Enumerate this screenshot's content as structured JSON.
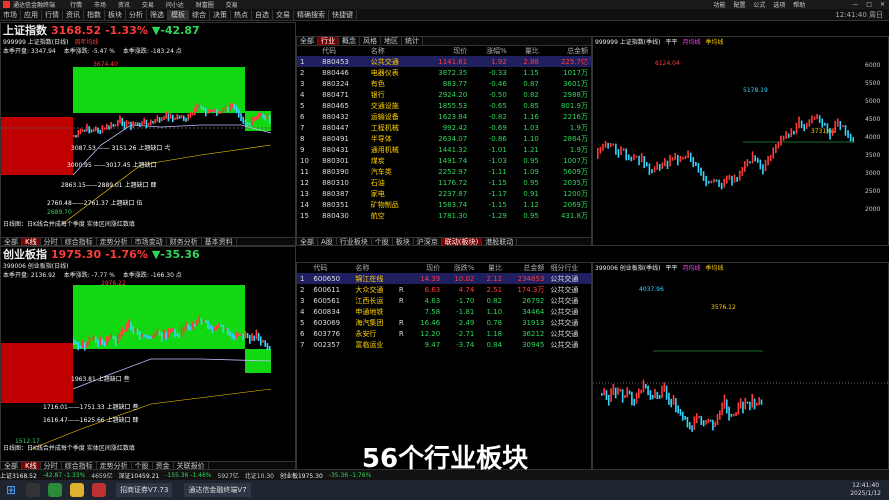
{
  "app": {
    "title": "通达信金融终端",
    "menu": [
      "行情",
      "市场",
      "资讯",
      "交易",
      "问小达",
      "财富圈",
      "交易"
    ],
    "window_controls": [
      "功能",
      "配置",
      "公式",
      "选项",
      "帮助"
    ]
  },
  "toolbar": [
    "市场",
    "应用",
    "行情",
    "资讯",
    "指数",
    "板块",
    "分析",
    "筛选",
    "模板",
    "综合",
    "决策",
    "热点",
    "自选",
    "交易"
  ],
  "toolbar_tail": [
    "精确搜索",
    "快捷键"
  ],
  "toolbar_right": "12:41:40 周日",
  "index1": {
    "code": "999999 上证指数(日线)",
    "name": "上证指数",
    "price": "3168.52",
    "pct": "-1.33%",
    "chg": "▼-42.87",
    "open_label": "本季开盘: 3347.94",
    "change_label": "本季涨跌: -5.47 %",
    "total_label": "本季涨跌: -183.24 点",
    "top_label": "3674.40",
    "low_label": "2689.70",
    "ma_label": "周年均线",
    "gaps": [
      "3087.53 —— 3151.26 上翘缺口 弌",
      "3000.95 ——3017.45 上翘缺口 ",
      "2863.15——2889.01 上翘缺口 肆",
      "2760.48——2761.37 上翘缺口 伍"
    ],
    "footer": "日线图：日K线合并成每个季度 实体区间涨红数填"
  },
  "index2": {
    "code": "399006 创业板指(日线)",
    "name": "创业板指",
    "price": "1975.30",
    "pct": "-1.76%",
    "chg": "▼-35.36",
    "open_label": "本季开盘: 2136.92",
    "change_label": "本季涨跌: -7.77 %",
    "total_label": "本季涨跌: -166.30 点",
    "top_label": "2976.22",
    "low_label": "1512.17",
    "gaps": [
      "1963.81 上翘缺口 叁",
      "1716.01——1751.33 上翘缺口 叁",
      "1616.47——1625.66 上翘缺口 肆"
    ],
    "footer": "日线图：日K线合并成每个季度 实体区间涨红数填"
  },
  "mid_tabs": [
    "全部",
    "行业",
    "概念",
    "风格",
    "地区",
    "统计"
  ],
  "mid_tab_active": "行业",
  "mid_header": [
    "",
    "代码",
    "名称",
    "现价",
    "涨幅%",
    "量比",
    "总金额"
  ],
  "sector_rows": [
    [
      "1",
      "880453",
      "公共交通",
      "1141.61",
      "1.92",
      "2.88",
      "225.7亿"
    ],
    [
      "2",
      "880446",
      "电器仪表",
      "3872.35",
      "-0.33",
      "1.15",
      "1017万"
    ],
    [
      "3",
      "880324",
      "有色",
      "883.77",
      "-0.46",
      "0.87",
      "3601万"
    ],
    [
      "4",
      "880471",
      "银行",
      "2924.20",
      "-0.50",
      "0.82",
      "2988万"
    ],
    [
      "5",
      "880465",
      "交通设施",
      "1855.53",
      "-0.65",
      "0.85",
      "801.9万"
    ],
    [
      "6",
      "880432",
      "运输设备",
      "1623.84",
      "-0.82",
      "1.16",
      "2216万"
    ],
    [
      "7",
      "880447",
      "工程机械",
      "992.42",
      "-0.69",
      "1.03",
      "1.9万"
    ],
    [
      "8",
      "880491",
      "半导体",
      "2634.07",
      "-0.86",
      "1.10",
      "2864万"
    ],
    [
      "9",
      "880431",
      "通用机械",
      "1441.32",
      "-1.01",
      "1.21",
      "1.9万"
    ],
    [
      "10",
      "880301",
      "煤炭",
      "1491.74",
      "-1.03",
      "0.95",
      "1007万"
    ],
    [
      "11",
      "880390",
      "汽车类",
      "2252.97",
      "-1.11",
      "1.09",
      "5609万"
    ],
    [
      "12",
      "880310",
      "石油",
      "1176.72",
      "-1.15",
      "0.95",
      "2035万"
    ],
    [
      "13",
      "880387",
      "家电",
      "2237.87",
      "-1.17",
      "0.91",
      "1200万"
    ],
    [
      "14",
      "880351",
      "矿物制品",
      "1583.74",
      "-1.15",
      "1.12",
      "2069万"
    ],
    [
      "15",
      "880430",
      "航空",
      "1781.30",
      "-1.29",
      "0.95",
      "431.8万"
    ]
  ],
  "stock_header": [
    "",
    "代码",
    "名称",
    "",
    "现价",
    "涨跌%",
    "量比",
    "总金额",
    "细分行业"
  ],
  "stock_rows": [
    [
      "1",
      "600650",
      "锦江在线",
      "",
      "14.39",
      "10.02",
      "2.12",
      "234853",
      "公共交通"
    ],
    [
      "2",
      "600611",
      "大众交通",
      "R",
      "6.63",
      "4.74",
      "2.51",
      "174.3万",
      "公共交通"
    ],
    [
      "3",
      "600561",
      "江西长运",
      "R",
      "4.63",
      "-1.70",
      "0.82",
      "26792",
      "公共交通"
    ],
    [
      "4",
      "600834",
      "申通地铁",
      "",
      "7.58",
      "-1.81",
      "1.10",
      "34464",
      "公共交通"
    ],
    [
      "5",
      "603069",
      "海汽集团",
      "R",
      "16.46",
      "-2.49",
      "0.78",
      "31913",
      "公共交通"
    ],
    [
      "6",
      "603776",
      "永安行",
      "R",
      "12.20",
      "-2.71",
      "1.18",
      "36212",
      "公共交通"
    ],
    [
      "7",
      "002357",
      "富临运业",
      "",
      "9.47",
      "-3.74",
      "0.84",
      "30945",
      "公共交通"
    ]
  ],
  "right1": {
    "code": "999999 上证指数(季线)",
    "legend": [
      "平平",
      "月均线",
      "季均线"
    ],
    "peak": "6124.04",
    "p2": "5178.19",
    "p3": "3731.69",
    "scale": [
      "6000",
      "5500",
      "5000",
      "4500",
      "4000",
      "3500",
      "3000",
      "2500",
      "2000"
    ],
    "years": [
      "2001",
      "6",
      "9",
      "12",
      "3",
      "6",
      "9",
      "12",
      "3"
    ]
  },
  "right2": {
    "code": "399006 创业板指(季线)",
    "legend": [
      "平平",
      "月均线",
      "季均线"
    ],
    "peak": "4037.96",
    "p2": "3576.12"
  },
  "tabs1": [
    "全部",
    "K线",
    "分时",
    "综合指标",
    "走势分析",
    "市场变动",
    "财务分析",
    "财务分析",
    "基本资料",
    "个股",
    "资金",
    "关联报价",
    "扩展行情"
  ],
  "tabs_mid": [
    "全部",
    "A股",
    "行业板块",
    "个股",
    "板块",
    "沪深京",
    "指数成分",
    "联动(板块)",
    "港股联动",
    "精选板块"
  ],
  "caption": "56个行业板块",
  "status": [
    "上证3168.52",
    "-42.87 -1.33%",
    "4659亿",
    "深证10459.21",
    "-155.36 -1.46%",
    "5927亿",
    "北证10.30",
    "创业板1975.30",
    "-35.36 -1.76%",
    "上证3168.52",
    "深证10459.21"
  ],
  "taskbar": [
    "招商证券V7.73",
    "通达信金融终端V7"
  ],
  "clock": {
    "time": "12:41:40",
    "date": "2025/1/12"
  },
  "colors": {
    "up": "#ff3b3b",
    "down": "#2fd65a",
    "bg": "#000000",
    "box_green": "#11d811",
    "box_red": "#cc0000"
  }
}
